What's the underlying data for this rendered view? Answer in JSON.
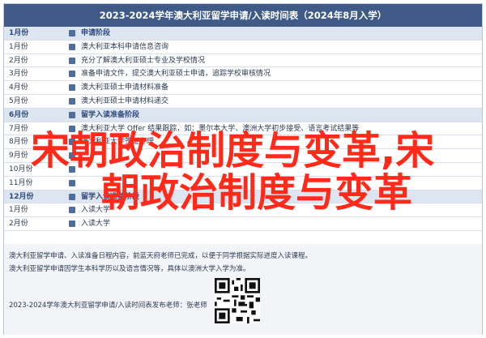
{
  "doc_title": "2023-2024学年澳大利亚留学申请/入读时间表（2024年8月入学）",
  "rows": [
    {
      "month": "1月份",
      "text": "申请阶段",
      "section": true
    },
    {
      "month": "1月份",
      "text": "澳大利亚本科申请信息咨询",
      "section": false
    },
    {
      "month": "2月份",
      "text": "充分了解澳大利亚硕士专业及学校情况",
      "section": false
    },
    {
      "month": "3月份",
      "text": "准备申请文件，提交澳大利亚硕士申请，追踪学校审核情况",
      "section": false
    },
    {
      "month": "4月份",
      "text": "澳大利亚硕士申请材料准备",
      "section": false
    },
    {
      "month": "5月份",
      "text": "澳大利亚硕士申请材料递交",
      "section": false
    },
    {
      "month": "6月份",
      "text": "留学入读准备阶段",
      "section": true
    },
    {
      "month": "7月份",
      "text": "澳大利亚大学 Offer 结果跟踪，如：墨尔本大学、澳洲大学初步接受、语言考试结果等",
      "section": false
    },
    {
      "month": "8月份",
      "text": "澳大利亚大学签证办理",
      "section": false
    },
    {
      "month": "9月份",
      "text": "",
      "section": false
    },
    {
      "month": "10月份",
      "text": "",
      "section": false
    },
    {
      "month": "11月份",
      "text": "",
      "section": false
    },
    {
      "month": "12月份",
      "text": "留学入读准备阶段",
      "section": true
    },
    {
      "month": "1月份",
      "text": "入读大学",
      "section": false
    },
    {
      "month": "2月份",
      "text": "入读大学",
      "section": false
    }
  ],
  "footer_lines": [
    "澳大利亚留学申请、入读准备日程内容，前蓝天府老师已完成，以便于同学根据实际进度入读课程。",
    "澳大利亚留学申请因学生本科学历以及语言情况等，具体以澳洲大学入学为准。",
    "2023-2024学年澳大利亚留学申请/入读时间表发布老师：张老师"
  ],
  "overlay": {
    "line1": "宋朝政治制度与变革,宋",
    "line2": "朝政治制度与变革",
    "color": "#ff2a1a"
  },
  "colors": {
    "header_bg": "#3f5a86",
    "section_bg": "#dde5f0",
    "accent_text": "#2d4a7a"
  }
}
